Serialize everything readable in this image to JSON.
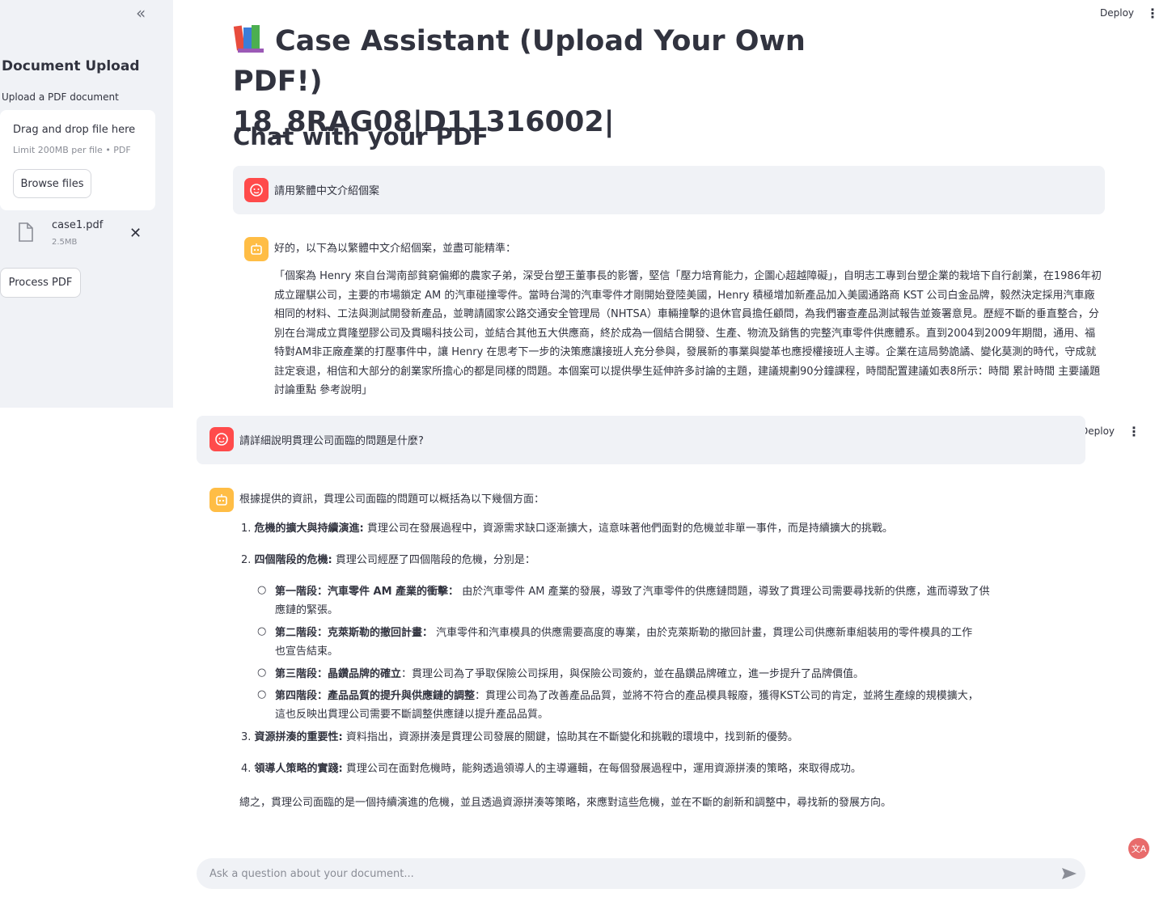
{
  "sidebar": {
    "collapse_glyph": "«",
    "title": "Document Upload",
    "upload_label": "Upload a PDF document",
    "dropzone": {
      "title": "Drag and drop file here",
      "limit": "Limit 200MB per file • PDF",
      "browse_label": "Browse files"
    },
    "file": {
      "name": "case1.pdf",
      "size": "2.5MB",
      "icon": "file-icon",
      "remove_glyph": "✕"
    },
    "process_label": "Process PDF"
  },
  "toolbar": {
    "deploy_label": "Deploy",
    "menu_glyph": "⋮"
  },
  "main": {
    "title_line1": "Case Assistant (Upload Your Own PDF!)",
    "title_line2": "18_8RAG08|D11316002|",
    "title_icon": "books-icon",
    "subheading": "Chat with your PDF"
  },
  "messages": [
    {
      "role": "user",
      "text": "請用繁體中文介紹個案"
    },
    {
      "role": "assistant",
      "intro": "好的，以下為以繁體中文介紹個案，並盡可能精準：",
      "body": "「個案為 Henry 來自台灣南部貧窮偏鄉的農家子弟，深受台塑王董事長的影響，堅信「壓力培育能力，企圖心超越障礙」，自明志工專到台塑企業的栽培下自行創業，在1986年初成立躍騏公司，主要的市場鎖定 AM 的汽車碰撞零件。當時台灣的汽車零件才剛開始登陸美國，Henry 積極增加新產品加入美國通路商 KST 公司白金品牌，毅然決定採用汽車廠相同的材料、工法與測試開發新產品，並聘請國家公路交通安全管理局（NHTSA）車輛撞擊的退休官員擔任顧問，為我們審查產品測試報告並簽署意見。歷經不斷的垂直整合，分別在台灣成立貫隆塑膠公司及貫暘科技公司，並結合其他五大供應商，終於成為一個結合開發、生產、物流及銷售的完整汽車零件供應體系。直到2004到2009年期間，通用、福特對AM非正廠產業的打壓事件中，讓 Henry 在思考下一步的決策應讓接班人充分參與，發展新的事業與變革也應授權接班人主導。企業在這局勢詭譎、變化莫測的時代，守成就註定衰退，相信和大部分的創業家所擔心的都是同樣的問題。本個案可以提供學生延伸許多討論的主題，建議規劃90分鐘課程，時間配置建議如表8所示：時間 累計時間 主要議題 討論重點 參考說明」"
    },
    {
      "role": "user",
      "text": "請詳細說明貫理公司面臨的問題是什麼?"
    },
    {
      "role": "assistant",
      "intro": "根據提供的資訊，貫理公司面臨的問題可以概括為以下幾個方面：",
      "items": [
        {
          "num": "1.",
          "bold": "危機的擴大與持續演進:",
          "text": " 貫理公司在發展過程中，資源需求缺口逐漸擴大，這意味著他們面對的危機並非單一事件，而是持續擴大的挑戰。"
        },
        {
          "num": "2.",
          "bold": "四個階段的危機:",
          "text": " 貫理公司經歷了四個階段的危機，分別是："
        },
        {
          "num": "3.",
          "bold": "資源拼湊的重要性:",
          "text": " 資料指出，資源拼湊是貫理公司發展的關鍵，協助其在不斷變化和挑戰的環境中，找到新的優勢。"
        },
        {
          "num": "4.",
          "bold": "領導人策略的實踐:",
          "text": " 貫理公司在面對危機時，能夠透過領導人的主導邏輯，在每個發展過程中，運用資源拼湊的策略，來取得成功。"
        }
      ],
      "subitems": [
        {
          "bold": "第一階段：汽車零件 AM 產業的衝擊：",
          "line1": " 由於汽車零件 AM 產業的發展，導致了汽車零件的供應鏈問題，導致了貫理公司需要尋找新的供應，進而導致了供",
          "line2": "應鏈的緊張。"
        },
        {
          "bold": "第二階段：克萊斯勒的撤回計畫：",
          "line1": " 汽車零件和汽車模具的供應需要高度的專業，由於克萊斯勒的撤回計畫，貫理公司供應新車組裝用的零件模具的工作",
          "line2": "也宣告結束。"
        },
        {
          "bold": "第三階段：晶鑽品牌的確立",
          "line1": "：貫理公司為了爭取保險公司採用，與保險公司簽約，並在晶鑽品牌確立，進一步提升了品牌價值。",
          "line2": ""
        },
        {
          "bold": "第四階段：產品品質的提升與供應鏈的調整",
          "line1": "：貫理公司為了改善產品品質，並將不符合的產品模具報廢，獲得KST公司的肯定，並將生產線的規模擴大，",
          "line2": "這也反映出貫理公司需要不斷調整供應鏈以提升產品品質。"
        }
      ],
      "summary": "總之，貫理公司面臨的是一個持續演進的危機，並且透過資源拼湊等策略，來應對這些危機，並在不斷的創新和調整中，尋找新的發展方向。"
    }
  ],
  "chat_input": {
    "placeholder": "Ask a question about your document...",
    "send_icon": "send-icon"
  },
  "translate_badge": "文A",
  "colors": {
    "sidebar_bg": "#f0f2f6",
    "user_avatar": "#ff4b4b",
    "bot_avatar": "#ffbd45",
    "text": "#31333f"
  }
}
